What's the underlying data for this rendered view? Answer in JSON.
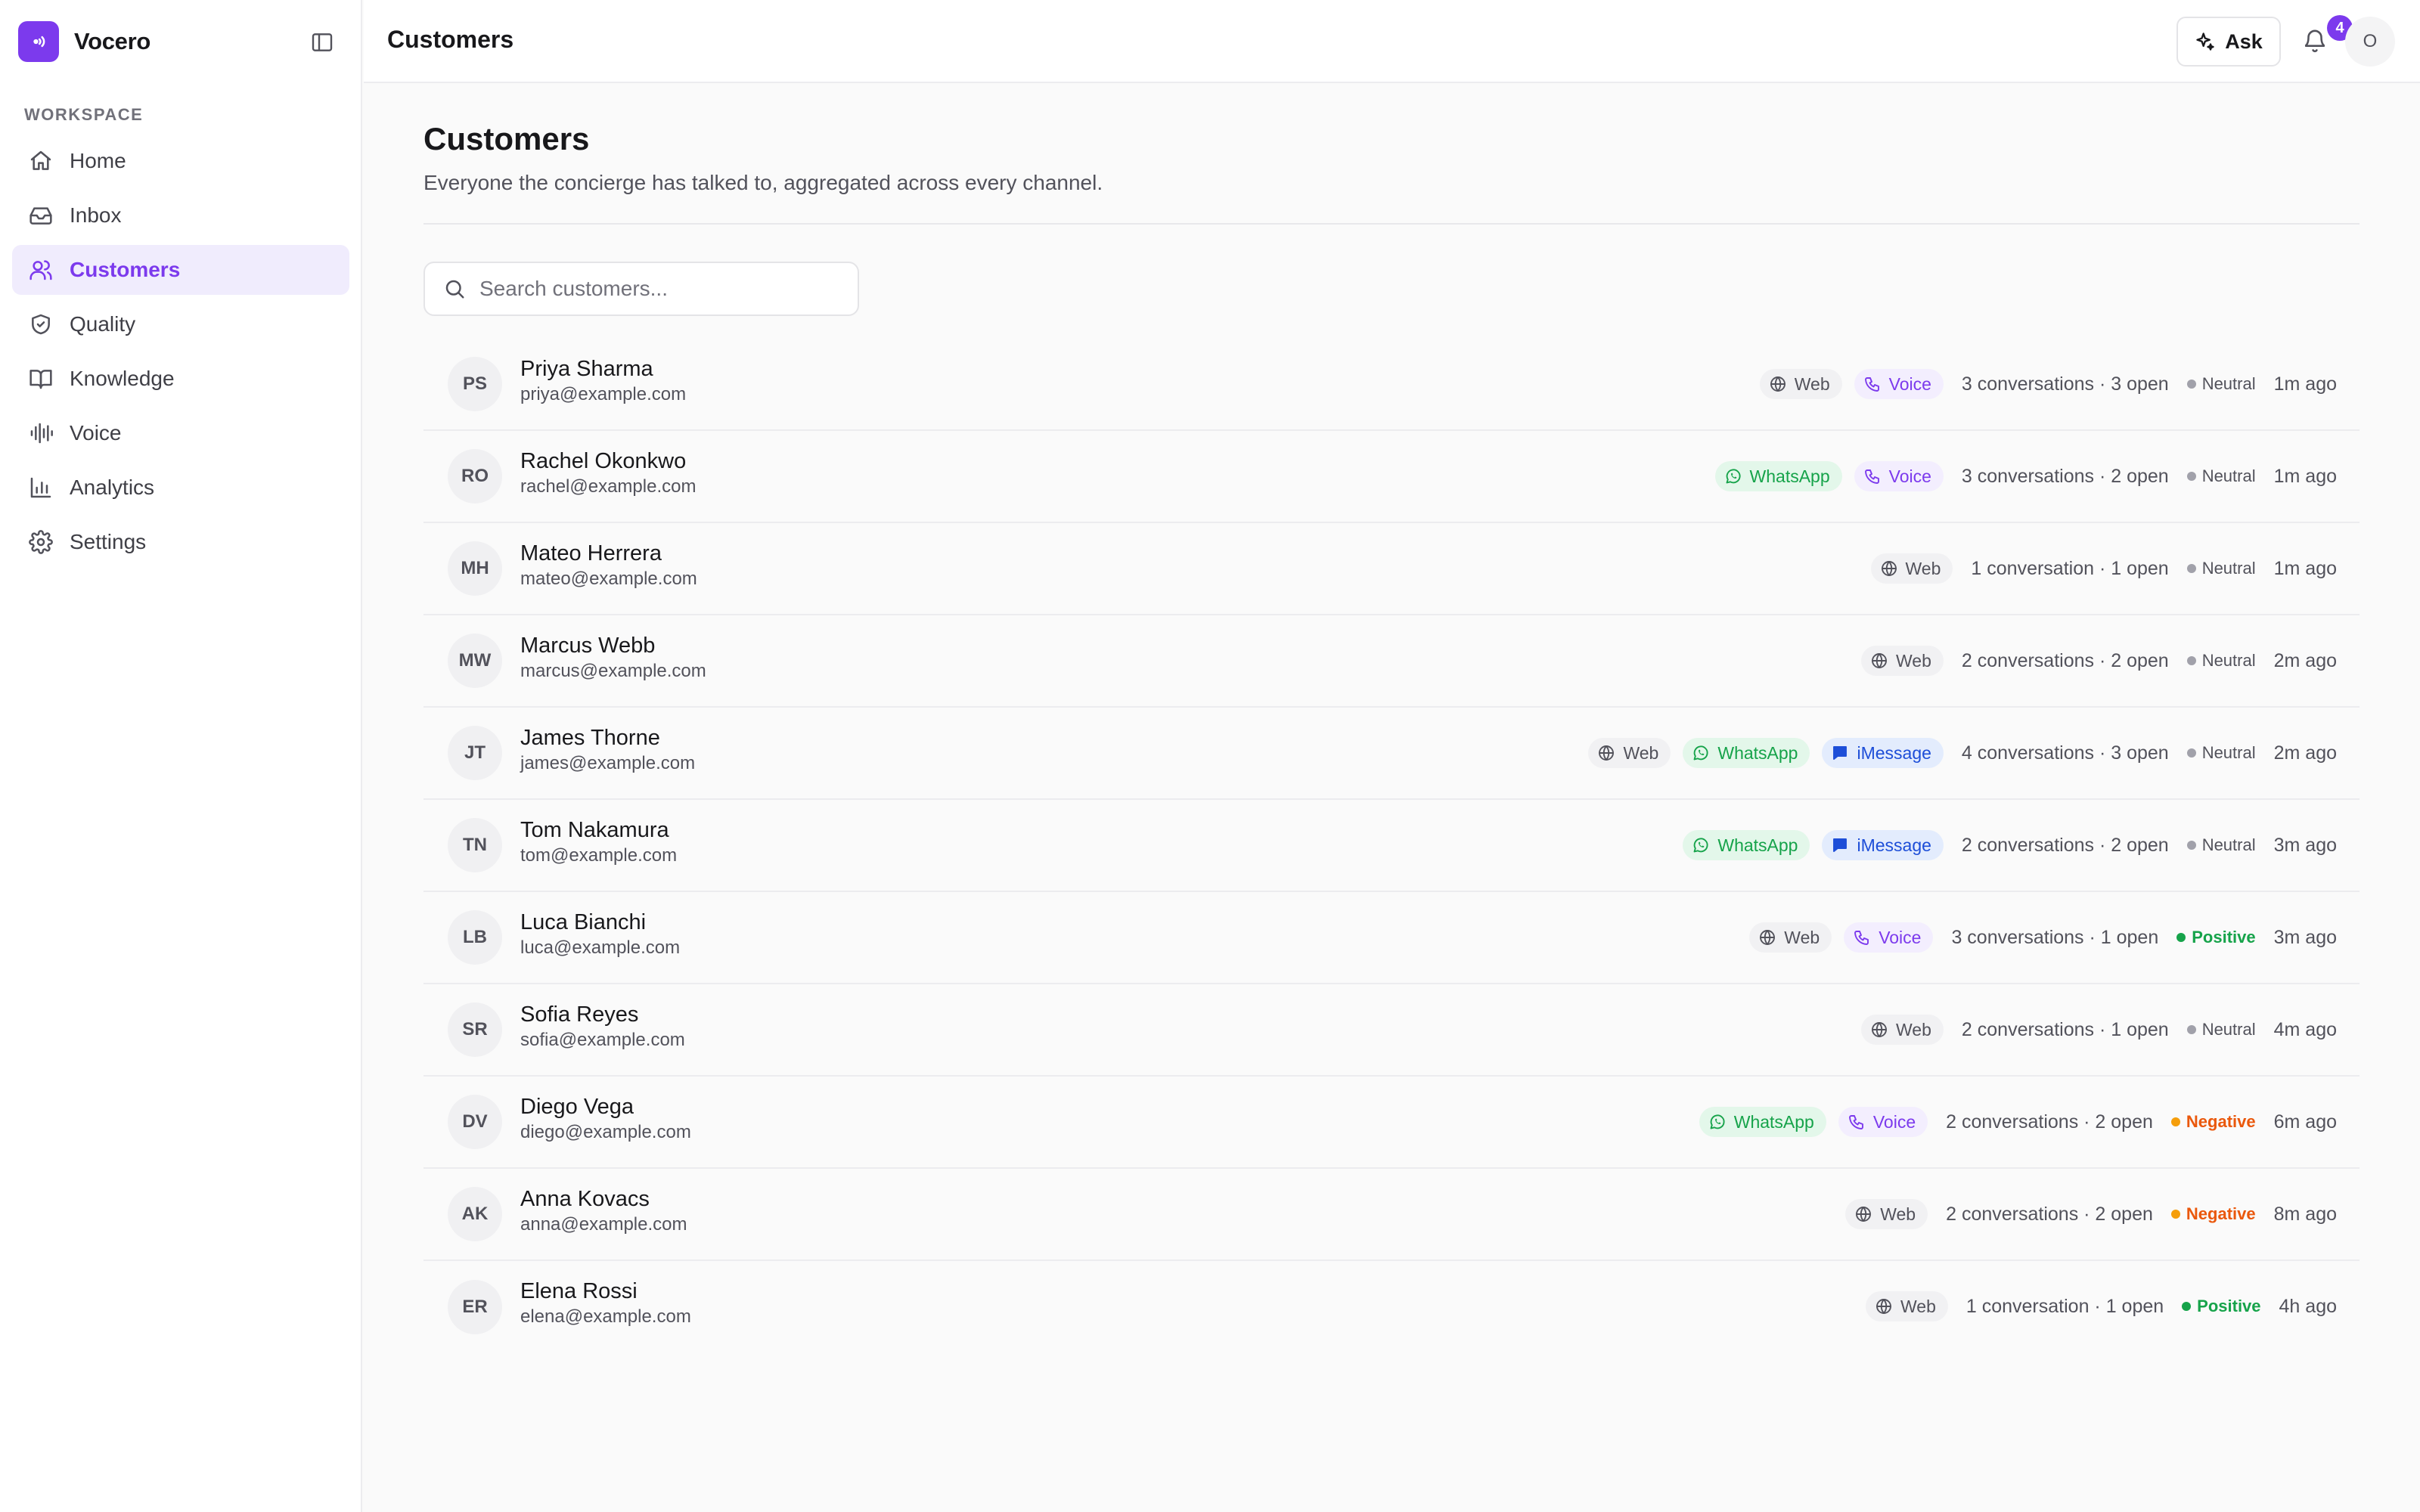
{
  "app": {
    "name": "Vocero"
  },
  "sidebar": {
    "section_label": "WORKSPACE",
    "items": [
      {
        "label": "Home",
        "icon": "home-icon",
        "active": false
      },
      {
        "label": "Inbox",
        "icon": "inbox-icon",
        "active": false
      },
      {
        "label": "Customers",
        "icon": "users-icon",
        "active": true
      },
      {
        "label": "Quality",
        "icon": "shield-icon",
        "active": false
      },
      {
        "label": "Knowledge",
        "icon": "book-icon",
        "active": false
      },
      {
        "label": "Voice",
        "icon": "waveform-icon",
        "active": false
      },
      {
        "label": "Analytics",
        "icon": "bar-chart-icon",
        "active": false
      },
      {
        "label": "Settings",
        "icon": "gear-icon",
        "active": false
      }
    ]
  },
  "header": {
    "title": "Customers",
    "ask_label": "Ask",
    "notification_count": "4",
    "user_initial": "O"
  },
  "main": {
    "title": "Customers",
    "subtitle": "Everyone the concierge has talked to, aggregated across every channel.",
    "search_placeholder": "Search customers..."
  },
  "channel_labels": {
    "web": "Web",
    "voice": "Voice",
    "whatsapp": "WhatsApp",
    "imessage": "iMessage"
  },
  "colors": {
    "accent": "#7c3aed",
    "positive": "#16a34a",
    "negative": "#ea580c",
    "whatsapp": "#16a34a",
    "imessage": "#1d4ed8"
  },
  "customers": [
    {
      "initials": "PS",
      "name": "Priya Sharma",
      "email": "priya@example.com",
      "channels": [
        "web",
        "voice"
      ],
      "conversations": "3 conversations · 3 open",
      "sentiment": "Neutral",
      "sentiment_key": "neutral",
      "time": "1m ago"
    },
    {
      "initials": "RO",
      "name": "Rachel Okonkwo",
      "email": "rachel@example.com",
      "channels": [
        "whatsapp",
        "voice"
      ],
      "conversations": "3 conversations · 2 open",
      "sentiment": "Neutral",
      "sentiment_key": "neutral",
      "time": "1m ago"
    },
    {
      "initials": "MH",
      "name": "Mateo Herrera",
      "email": "mateo@example.com",
      "channels": [
        "web"
      ],
      "conversations": "1 conversation · 1 open",
      "sentiment": "Neutral",
      "sentiment_key": "neutral",
      "time": "1m ago"
    },
    {
      "initials": "MW",
      "name": "Marcus Webb",
      "email": "marcus@example.com",
      "channels": [
        "web"
      ],
      "conversations": "2 conversations · 2 open",
      "sentiment": "Neutral",
      "sentiment_key": "neutral",
      "time": "2m ago"
    },
    {
      "initials": "JT",
      "name": "James Thorne",
      "email": "james@example.com",
      "channels": [
        "web",
        "whatsapp",
        "imessage"
      ],
      "conversations": "4 conversations · 3 open",
      "sentiment": "Neutral",
      "sentiment_key": "neutral",
      "time": "2m ago"
    },
    {
      "initials": "TN",
      "name": "Tom Nakamura",
      "email": "tom@example.com",
      "channels": [
        "whatsapp",
        "imessage"
      ],
      "conversations": "2 conversations · 2 open",
      "sentiment": "Neutral",
      "sentiment_key": "neutral",
      "time": "3m ago"
    },
    {
      "initials": "LB",
      "name": "Luca Bianchi",
      "email": "luca@example.com",
      "channels": [
        "web",
        "voice"
      ],
      "conversations": "3 conversations · 1 open",
      "sentiment": "Positive",
      "sentiment_key": "positive",
      "time": "3m ago"
    },
    {
      "initials": "SR",
      "name": "Sofia Reyes",
      "email": "sofia@example.com",
      "channels": [
        "web"
      ],
      "conversations": "2 conversations · 1 open",
      "sentiment": "Neutral",
      "sentiment_key": "neutral",
      "time": "4m ago"
    },
    {
      "initials": "DV",
      "name": "Diego Vega",
      "email": "diego@example.com",
      "channels": [
        "whatsapp",
        "voice"
      ],
      "conversations": "2 conversations · 2 open",
      "sentiment": "Negative",
      "sentiment_key": "negative",
      "time": "6m ago"
    },
    {
      "initials": "AK",
      "name": "Anna Kovacs",
      "email": "anna@example.com",
      "channels": [
        "web"
      ],
      "conversations": "2 conversations · 2 open",
      "sentiment": "Negative",
      "sentiment_key": "negative",
      "time": "8m ago"
    },
    {
      "initials": "ER",
      "name": "Elena Rossi",
      "email": "elena@example.com",
      "channels": [
        "web"
      ],
      "conversations": "1 conversation · 1 open",
      "sentiment": "Positive",
      "sentiment_key": "positive",
      "time": "4h ago"
    }
  ]
}
